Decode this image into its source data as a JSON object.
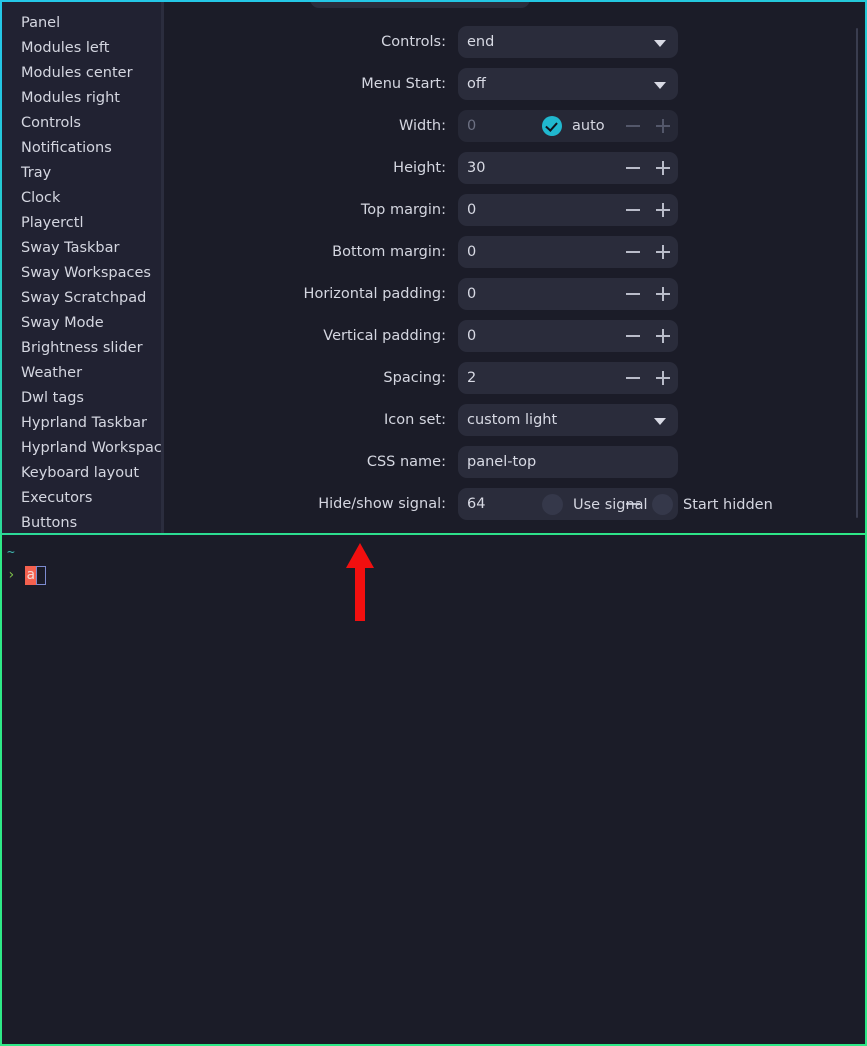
{
  "window": {
    "border_color_top": "#25c8e8",
    "border_color_bottom": "#2ee887",
    "background": "#1b1c28"
  },
  "sidebar": {
    "background": "#212232",
    "items": [
      {
        "label": "Panel"
      },
      {
        "label": "Modules left"
      },
      {
        "label": "Modules center"
      },
      {
        "label": "Modules right"
      },
      {
        "label": "Controls"
      },
      {
        "label": "Notifications"
      },
      {
        "label": "Tray"
      },
      {
        "label": "Clock"
      },
      {
        "label": "Playerctl"
      },
      {
        "label": "Sway Taskbar"
      },
      {
        "label": "Sway Workspaces"
      },
      {
        "label": "Sway Scratchpad"
      },
      {
        "label": "Sway Mode"
      },
      {
        "label": "Brightness slider"
      },
      {
        "label": "Weather"
      },
      {
        "label": "Dwl tags"
      },
      {
        "label": "Hyprland Taskbar"
      },
      {
        "label": "Hyprland Workspaces"
      },
      {
        "label": "Keyboard layout"
      },
      {
        "label": "Executors"
      },
      {
        "label": "Buttons"
      }
    ]
  },
  "form": {
    "rows": [
      {
        "label": "Controls:",
        "type": "combo",
        "value": "end",
        "name": "controls",
        "icon": "chevron-down-icon"
      },
      {
        "label": "Menu Start:",
        "type": "combo",
        "value": "off",
        "name": "menu-start",
        "icon": "chevron-down-icon"
      },
      {
        "label": "Width:",
        "type": "spin",
        "value": "0",
        "name": "width",
        "disabled": true
      },
      {
        "label": "Height:",
        "type": "spin",
        "value": "30",
        "name": "height",
        "disabled": false
      },
      {
        "label": "Top margin:",
        "type": "spin",
        "value": "0",
        "name": "top-margin",
        "disabled": false
      },
      {
        "label": "Bottom margin:",
        "type": "spin",
        "value": "0",
        "name": "bottom-margin",
        "disabled": false
      },
      {
        "label": "Horizontal padding:",
        "type": "spin",
        "value": "0",
        "name": "horizontal-padding",
        "disabled": false
      },
      {
        "label": "Vertical padding:",
        "type": "spin",
        "value": "0",
        "name": "vertical-padding",
        "disabled": false
      },
      {
        "label": "Spacing:",
        "type": "spin",
        "value": "2",
        "name": "spacing",
        "disabled": false
      },
      {
        "label": "Icon set:",
        "type": "combo",
        "value": "custom light",
        "name": "icon-set",
        "icon": "chevron-down-icon"
      },
      {
        "label": "CSS name:",
        "type": "text",
        "value": "panel-top",
        "name": "css-name"
      },
      {
        "label": "Hide/show signal:",
        "type": "spin",
        "value": "64",
        "name": "hide-show-signal",
        "disabled": false
      }
    ],
    "side_controls": {
      "auto": {
        "label": "auto",
        "checked": true,
        "color": "#20b8cf"
      },
      "use_signal": {
        "label": "Use signal",
        "checked": false
      },
      "start_hidden": {
        "label": "Start hidden",
        "checked": false
      }
    }
  },
  "terminal": {
    "cwd": "~",
    "sigil": "›",
    "typed": "a",
    "cwd_color": "#3fb8b0",
    "sigil_color": "#7fc04a",
    "typed_bg": "#f4614f"
  },
  "annotation": {
    "arrow_color": "#f20f0f",
    "direction": "up"
  }
}
